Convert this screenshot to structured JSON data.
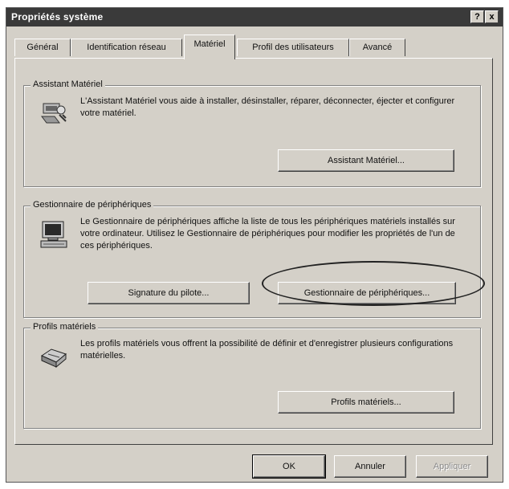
{
  "window": {
    "title": "Propriétés système",
    "help_label": "?",
    "close_label": "x"
  },
  "tabs": [
    {
      "label": "Général"
    },
    {
      "label": "Identification réseau"
    },
    {
      "label": "Matériel",
      "active": true
    },
    {
      "label": "Profil des utilisateurs"
    },
    {
      "label": "Avancé"
    }
  ],
  "hardware_wizard": {
    "title": "Assistant Matériel",
    "description": "L'Assistant Matériel vous aide à installer, désinstaller, réparer, déconnecter, éjecter et configurer votre matériel.",
    "button": "Assistant Matériel...",
    "icon": "hardware-wizard-icon"
  },
  "device_manager": {
    "title": "Gestionnaire de périphériques",
    "description": "Le Gestionnaire de périphériques affiche la liste de tous les périphériques matériels installés sur votre ordinateur. Utilisez le Gestionnaire de périphériques pour modifier les propriétés de l'un de ces périphériques.",
    "signing_button": "Signature du pilote...",
    "manager_button": "Gestionnaire de périphériques...",
    "icon": "computer-icon"
  },
  "hardware_profiles": {
    "title": "Profils matériels",
    "description": "Les profils matériels vous offrent la possibilité de définir et d'enregistrer plusieurs configurations matérielles.",
    "button": "Profils matériels...",
    "icon": "hardware-profiles-icon"
  },
  "footer": {
    "ok": "OK",
    "cancel": "Annuler",
    "apply": "Appliquer"
  }
}
